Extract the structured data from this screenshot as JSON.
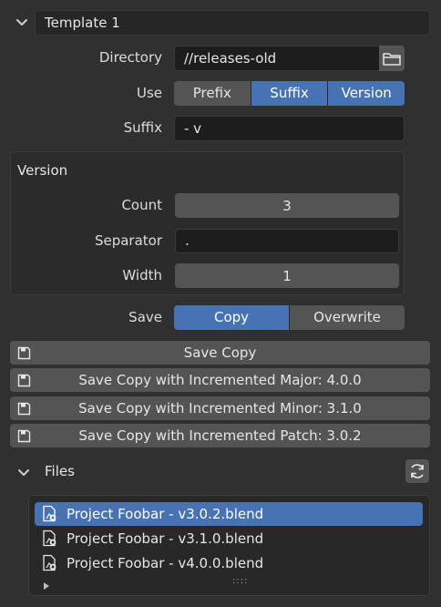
{
  "panel": {
    "title": "Template 1"
  },
  "directory": {
    "label": "Directory",
    "value": "//releases-old",
    "browse_icon": "folder-icon"
  },
  "use": {
    "label": "Use",
    "options": [
      "Prefix",
      "Suffix",
      "Version"
    ],
    "active": [
      "Suffix",
      "Version"
    ]
  },
  "suffix": {
    "label": "Suffix",
    "value": "- v"
  },
  "version": {
    "title": "Version",
    "count_label": "Count",
    "count_value": "3",
    "separator_label": "Separator",
    "separator_value": ".",
    "width_label": "Width",
    "width_value": "1"
  },
  "save": {
    "label": "Save",
    "options": [
      "Copy",
      "Overwrite"
    ],
    "active": "Copy"
  },
  "actions": [
    {
      "label": "Save Copy",
      "icon": "save-icon"
    },
    {
      "label": "Save Copy with Incremented Major: 4.0.0",
      "icon": "save-icon"
    },
    {
      "label": "Save Copy with Incremented Minor: 3.1.0",
      "icon": "save-icon"
    },
    {
      "label": "Save Copy with Incremented Patch: 3.0.2",
      "icon": "save-icon"
    }
  ],
  "files": {
    "title": "Files",
    "refresh_icon": "refresh-icon",
    "items": [
      {
        "name": "Project Foobar - v3.0.2.blend",
        "selected": true
      },
      {
        "name": "Project Foobar - v3.1.0.blend",
        "selected": false
      },
      {
        "name": "Project Foobar - v4.0.0.blend",
        "selected": false
      }
    ],
    "grip": "::::"
  },
  "colors": {
    "accent": "#4772b3",
    "background": "#303030",
    "field": "#1d1d1d",
    "button": "#545454"
  }
}
